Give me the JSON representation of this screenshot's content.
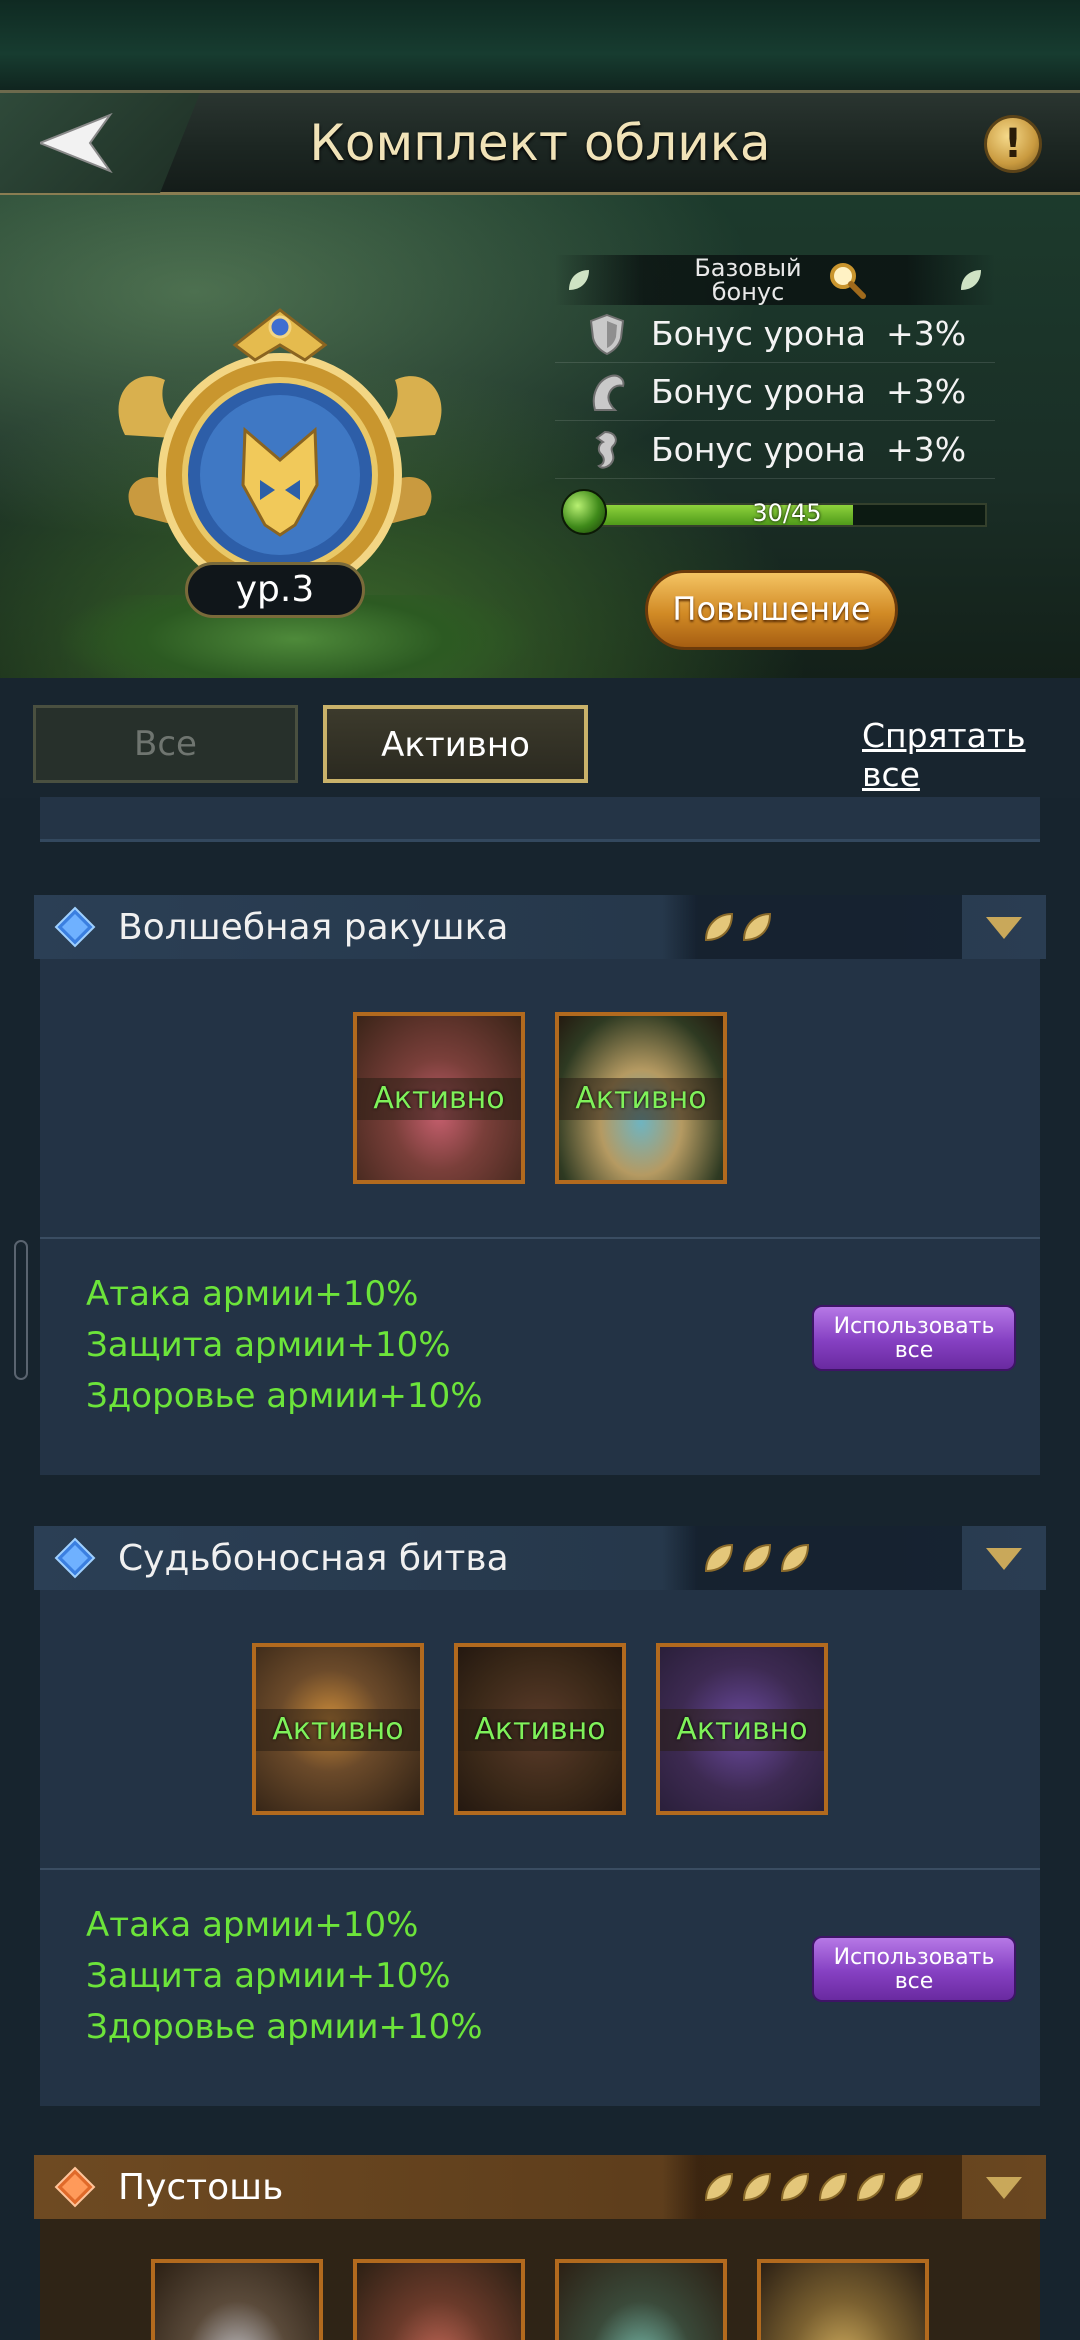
{
  "header": {
    "title": "Комплект облика",
    "back_label": "",
    "info_label": "!"
  },
  "hero": {
    "level": "ур.3",
    "bonus_title": "Базовый бонус",
    "bonuses": [
      {
        "icon": "shield-icon",
        "label": "Бонус урона",
        "value": "+3%"
      },
      {
        "icon": "wolf-icon",
        "label": "Бонус урона",
        "value": "+3%"
      },
      {
        "icon": "seahorse-icon",
        "label": "Бонус урона",
        "value": "+3%"
      }
    ],
    "progress_text": "30/45",
    "progress_fraction": 0.667,
    "upgrade_label": "Повышение"
  },
  "tabs": {
    "all_label": "Все",
    "active_label": "Активно",
    "hide_all_label": "Спрятать все"
  },
  "sets": [
    {
      "name": "Волшебная ракушка",
      "leaf_count": 2,
      "items": [
        {
          "status": "Активно",
          "colors": [
            "#5b3a2a",
            "#c65f6e"
          ]
        },
        {
          "status": "Активно",
          "colors": [
            "#3a4a2a",
            "#6fb4c0"
          ]
        }
      ],
      "stats": [
        "Атака армии+10%",
        "Защита армии+10%",
        "Здоровье армии+10%"
      ],
      "use_all_label": "Использовать все"
    },
    {
      "name": "Судьбоносная битва",
      "leaf_count": 3,
      "items": [
        {
          "status": "Активно",
          "colors": [
            "#4a3320",
            "#c98a3a"
          ]
        },
        {
          "status": "Активно",
          "colors": [
            "#3a2818",
            "#5c3c2a"
          ]
        },
        {
          "status": "Активно",
          "colors": [
            "#3d2a52",
            "#6b4aa0"
          ]
        }
      ],
      "stats": [
        "Атака армии+10%",
        "Защита армии+10%",
        "Здоровье армии+10%"
      ],
      "use_all_label": "Использовать все"
    }
  ],
  "wasteland": {
    "name": "Пустошь",
    "leaf_count": 6
  },
  "colors": {
    "accent_green": "#6ce43a",
    "active_label_green": "#7ff15a",
    "upgrade_orange": "#d18a25",
    "use_all_purple": "#8540c2",
    "card_blue": "#233345"
  }
}
